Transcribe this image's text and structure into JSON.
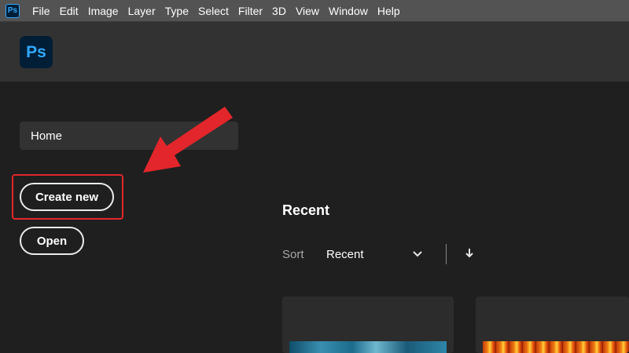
{
  "menubar": {
    "app_icon": "Ps",
    "items": [
      "File",
      "Edit",
      "Image",
      "Layer",
      "Type",
      "Select",
      "Filter",
      "3D",
      "View",
      "Window",
      "Help"
    ]
  },
  "header": {
    "logo": "Ps"
  },
  "sidebar": {
    "home_label": "Home",
    "create_new_label": "Create new",
    "open_label": "Open"
  },
  "recent": {
    "title": "Recent",
    "sort_label": "Sort",
    "sort_value": "Recent"
  },
  "colors": {
    "accent": "#31a8ff",
    "annotation": "#e3262b"
  },
  "icons": {
    "sort_dropdown": "chevron-down-icon",
    "sort_direction": "arrow-down-icon",
    "annotation": "arrow-icon"
  }
}
